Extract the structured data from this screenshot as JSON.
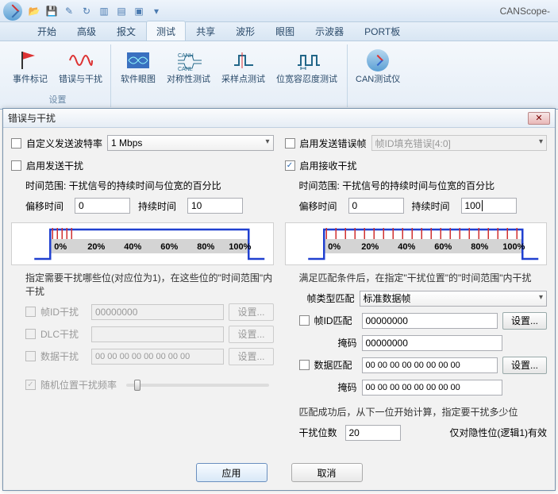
{
  "app_title": "CANScope-",
  "tabs": [
    "开始",
    "高级",
    "报文",
    "测试",
    "共享",
    "波形",
    "眼图",
    "示波器",
    "PORT板"
  ],
  "active_tab_index": 3,
  "ribbon": {
    "group1_label": "设置",
    "items": [
      {
        "label": "事件标记"
      },
      {
        "label": "错误与干扰"
      },
      {
        "label": "软件眼图"
      },
      {
        "label": "对称性测试"
      },
      {
        "label": "采样点测试"
      },
      {
        "label": "位宽容忍度测试"
      },
      {
        "label": "CAN测试仪"
      }
    ]
  },
  "dialog": {
    "title": "错误与干扰",
    "baud_label": "自定义发送波特率",
    "baud_value": "1 Mbps",
    "err_send_label": "启用发送错误帧",
    "err_send_combo": "帧ID填充错误[4:0]",
    "send_intf_label": "启用发送干扰",
    "recv_intf_label": "启用接收干扰",
    "time_range_label": "时间范围: 干扰信号的持续时间与位宽的百分比",
    "offset_label": "偏移时间",
    "duration_label": "持续时间",
    "left": {
      "offset": "0",
      "duration": "10"
    },
    "right": {
      "offset": "0",
      "duration": "100"
    },
    "ticks": [
      "0%",
      "20%",
      "40%",
      "60%",
      "80%",
      "100%"
    ],
    "left_note": "指定需要干扰哪些位(对应位为1)，在这些位的\"时间范围\"内干扰",
    "frame_id_intf_label": "帧ID干扰",
    "frame_id_intf_val": "00000000",
    "dlc_intf_label": "DLC干扰",
    "data_intf_label": "数据干扰",
    "data_intf_val": "00 00 00 00 00 00 00 00",
    "set_btn": "设置...",
    "rand_label": "随机位置干扰频率",
    "right_note": "满足匹配条件后，在指定\"干扰位置\"的\"时间范围\"内干扰",
    "frame_type_label": "帧类型匹配",
    "frame_type_val": "标准数据帧",
    "frame_id_match_label": "帧ID匹配",
    "frame_id_match_val": "00000000",
    "mask_label": "掩码",
    "mask_val": "00000000",
    "data_match_label": "数据匹配",
    "data_match_val": "00 00 00 00 00 00 00 00",
    "data_mask_val": "00 00 00 00 00 00 00 00",
    "match_note": "匹配成功后，从下一位开始计算，指定要干扰多少位",
    "intf_bits_label": "干扰位数",
    "intf_bits_val": "20",
    "intf_bits_note": "仅对隐性位(逻辑1)有效",
    "apply": "应用",
    "cancel": "取消"
  }
}
